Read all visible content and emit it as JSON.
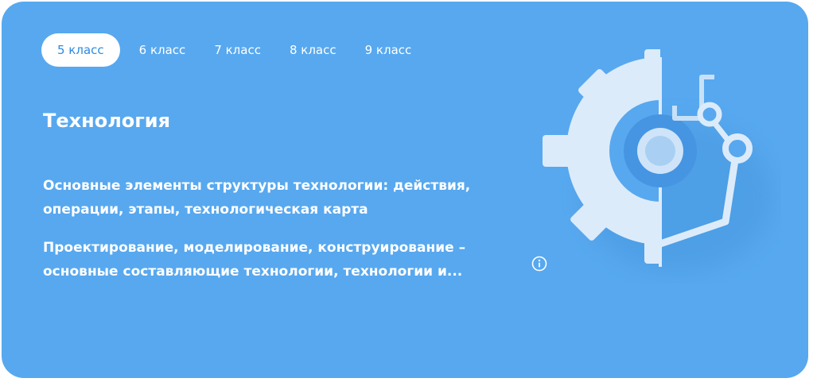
{
  "tabs": [
    {
      "label": "5 класс",
      "active": true
    },
    {
      "label": "6 класс",
      "active": false
    },
    {
      "label": "7 класс",
      "active": false
    },
    {
      "label": "8 класс",
      "active": false
    },
    {
      "label": "9 класс",
      "active": false
    }
  ],
  "subject": {
    "title": "Технология"
  },
  "topics": [
    {
      "text": "Основные элементы структуры технологии: действия, операции, этапы, технологическая карта"
    },
    {
      "text": "Проектирование, моделирование, конструирование – основные составляющие технологии, технологии и..."
    }
  ],
  "icons": {
    "info": "info-icon",
    "illustration": "gear-robot-arm-icon"
  },
  "colors": {
    "card_background": "#57a8ef",
    "active_tab_background": "#ffffff",
    "active_tab_text": "#2f8be0",
    "text": "#ffffff"
  }
}
